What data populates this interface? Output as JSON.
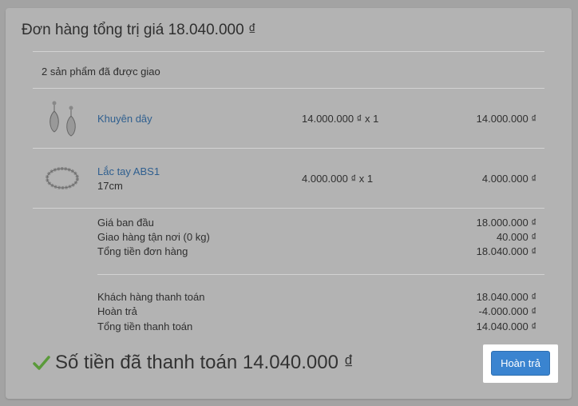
{
  "order": {
    "title": "Đơn hàng tổng trị giá 18.040.000 ₫",
    "shipped_label": "2 sản phẩm đã được giao",
    "items": [
      {
        "name": "Khuyên dây",
        "variant": "",
        "qty_text": "14.000.000 ₫ x 1",
        "total": "14.000.000 ₫",
        "icon": "earring-icon"
      },
      {
        "name": "Lắc tay ABS1",
        "variant": "17cm",
        "qty_text": "4.000.000 ₫ x 1",
        "total": "4.000.000 ₫",
        "icon": "bracelet-icon"
      }
    ],
    "summary": [
      {
        "label": "Giá ban đầu",
        "value": "18.000.000 ₫"
      },
      {
        "label": "Giao hàng tận nơi (0 kg)",
        "value": "40.000 ₫"
      },
      {
        "label": "Tổng tiền đơn hàng",
        "value": "18.040.000 ₫"
      }
    ],
    "payment": [
      {
        "label": "Khách hàng thanh toán",
        "value": "18.040.000 ₫"
      },
      {
        "label": "Hoàn trả",
        "value": "-4.000.000 ₫"
      },
      {
        "label": "Tổng tiền thanh toán",
        "value": "14.040.000 ₫"
      }
    ],
    "paid_text": "Số tiền đã thanh toán 14.040.000 ₫",
    "refund_button": "Hoàn trả"
  },
  "colors": {
    "accent": "#3a84d0",
    "check": "#5a9a3a",
    "link": "#2f5f8f"
  }
}
